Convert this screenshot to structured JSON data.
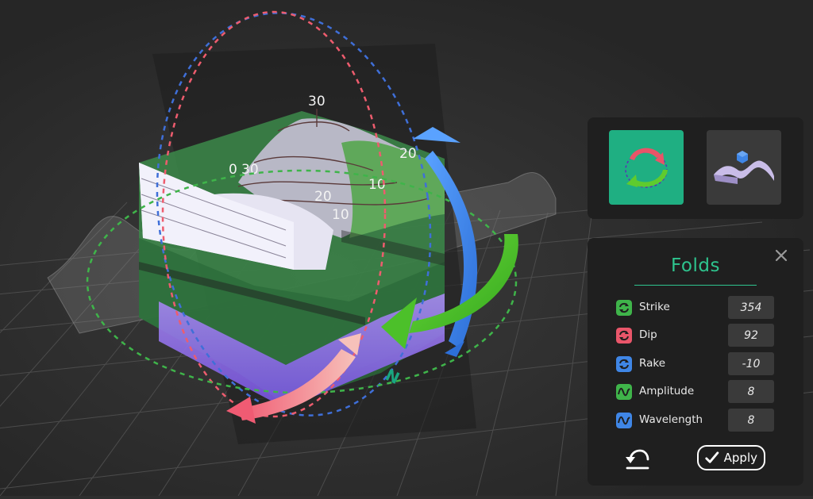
{
  "viewport": {
    "contour_labels": [
      "30",
      "20",
      "0",
      "30",
      "20",
      "10",
      "10"
    ],
    "compass_label": "N"
  },
  "toolbar": {
    "modes": [
      {
        "icon": "rotate-icon",
        "active": true
      },
      {
        "icon": "fold-surface-icon",
        "active": false
      }
    ]
  },
  "folds_panel": {
    "title": "Folds",
    "params": [
      {
        "icon": "rotate-arrows-icon",
        "color": "#3fb44a",
        "label": "Strike",
        "value": "354"
      },
      {
        "icon": "rotate-arrows-icon",
        "color": "#e9566a",
        "label": "Dip",
        "value": "92"
      },
      {
        "icon": "rotate-arrows-icon",
        "color": "#3f86e6",
        "label": "Rake",
        "value": "-10"
      },
      {
        "icon": "wave-icon",
        "color": "#3fb44a",
        "label": "Amplitude",
        "value": "8"
      },
      {
        "icon": "wave-icon",
        "color": "#3f86e6",
        "label": "Wavelength",
        "value": "8"
      }
    ],
    "apply_label": "Apply"
  },
  "colors": {
    "accent": "#2ec48e",
    "strike": "#3fb44a",
    "dip": "#e9566a",
    "rake": "#3f86e6"
  }
}
